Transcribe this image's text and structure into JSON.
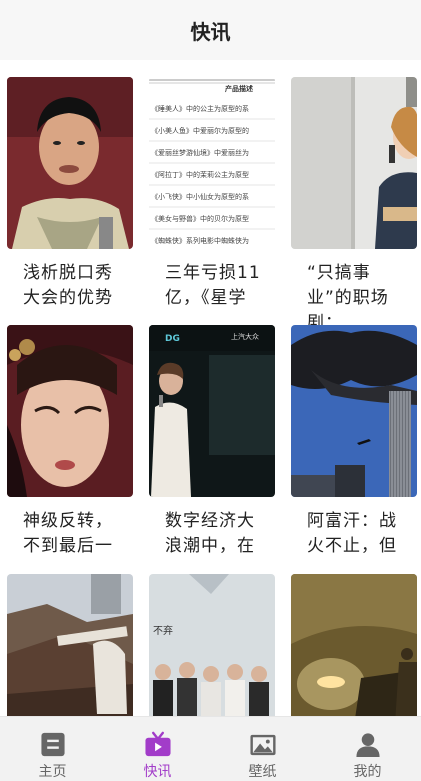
{
  "header": {
    "title": "快讯"
  },
  "cards": [
    {
      "title": "浅析脱口秀大会的优势",
      "image": "photo-man-on-stage"
    },
    {
      "title": "三年亏损11亿，《星学",
      "image": "document-text-list"
    },
    {
      "title": "“只搞事业”的职场剧：",
      "image": "photo-woman-on-phone"
    },
    {
      "title": "神级反转，不到最后一",
      "image": "photo-woman-headpiece"
    },
    {
      "title": "数字经济大浪潮中，在",
      "image": "photo-singer-stage"
    },
    {
      "title": "阿富汗：战火不止，但",
      "image": "photo-tower-smoke"
    },
    {
      "title": "",
      "image": "photo-rooftops"
    },
    {
      "title": "",
      "image": "photo-group-event"
    },
    {
      "title": "",
      "image": "photo-battle-fire"
    }
  ],
  "doc_text": {
    "heading": "产品描述",
    "lines": [
      "《睡美人》中的公主为原型的系",
      "《小美人鱼》中爱丽尔为原型的",
      "《爱丽丝梦游仙境》中爱丽丝为",
      "《阿拉丁》中的茉莉公主为原型",
      "《小飞侠》中小仙女为原型的系",
      "《美女与野兽》中的贝尔为原型",
      "《蜘蛛侠》系列电影中蜘蛛侠为"
    ]
  },
  "stage_text": {
    "left": "DG",
    "right": "上汽大众"
  },
  "event_text": "不弃",
  "tabs": [
    {
      "label": "主页",
      "icon": "home-icon",
      "active": false
    },
    {
      "label": "快讯",
      "icon": "tv-icon",
      "active": true
    },
    {
      "label": "壁纸",
      "icon": "image-icon",
      "active": false
    },
    {
      "label": "我的",
      "icon": "user-icon",
      "active": false
    }
  ],
  "colors": {
    "accent": "#a23cc9",
    "inactive": "#666666",
    "header_bg": "#f7f7f7"
  }
}
